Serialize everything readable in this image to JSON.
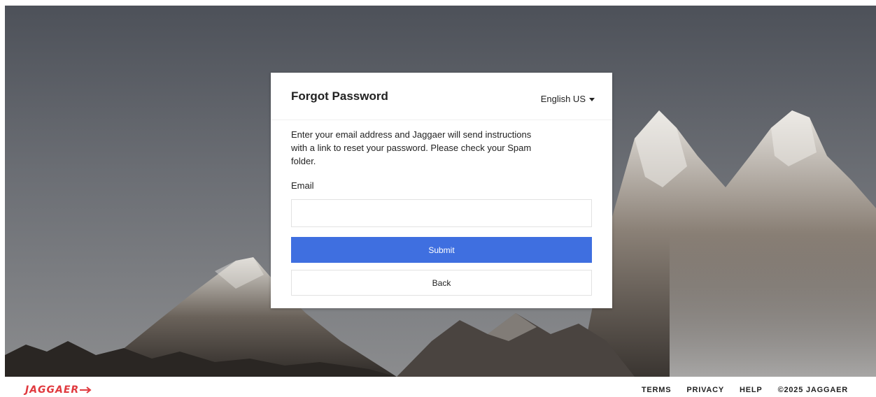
{
  "card": {
    "title": "Forgot Password",
    "language": "English US",
    "instructions": "Enter your email address and Jaggaer will send instructions with a link to reset your password. Please check your Spam folder.",
    "email_label": "Email",
    "email_value": "",
    "submit_label": "Submit",
    "back_label": "Back"
  },
  "footer": {
    "logo_text": "JAGGAER",
    "links": [
      "TERMS",
      "PRIVACY",
      "HELP"
    ],
    "copyright": "©2025 JAGGAER"
  },
  "colors": {
    "primary_button": "#3f6fe0",
    "logo_red": "#e0393e"
  }
}
